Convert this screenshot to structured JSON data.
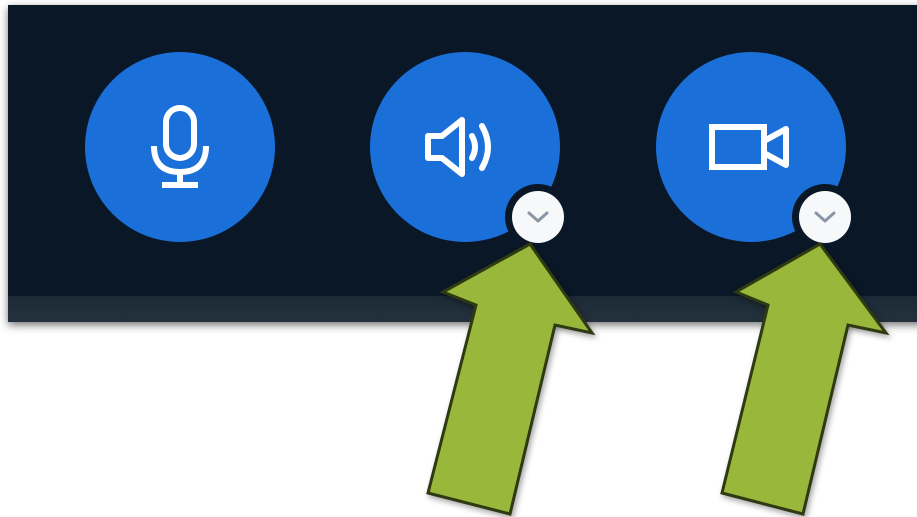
{
  "toolbar": {
    "buttons": [
      {
        "icon": "microphone-icon",
        "has_dropdown": false
      },
      {
        "icon": "speaker-icon",
        "has_dropdown": true,
        "dropdown_icon": "chevron-down-icon"
      },
      {
        "icon": "camera-icon",
        "has_dropdown": true,
        "dropdown_icon": "chevron-down-icon"
      }
    ]
  },
  "annotations": {
    "arrows": [
      {
        "icon": "callout-arrow",
        "points_to": "speaker-options-dropdown"
      },
      {
        "icon": "callout-arrow",
        "points_to": "camera-options-dropdown"
      }
    ]
  },
  "colors": {
    "toolbar_bg": "#0a1727",
    "button_blue": "#1a6fd8",
    "icon_white": "#ffffff",
    "badge_bg": "#f7f8fa",
    "chevron_gray": "#8a96a6",
    "arrow_green": "#99b83b",
    "arrow_outline": "#2f3a12"
  }
}
